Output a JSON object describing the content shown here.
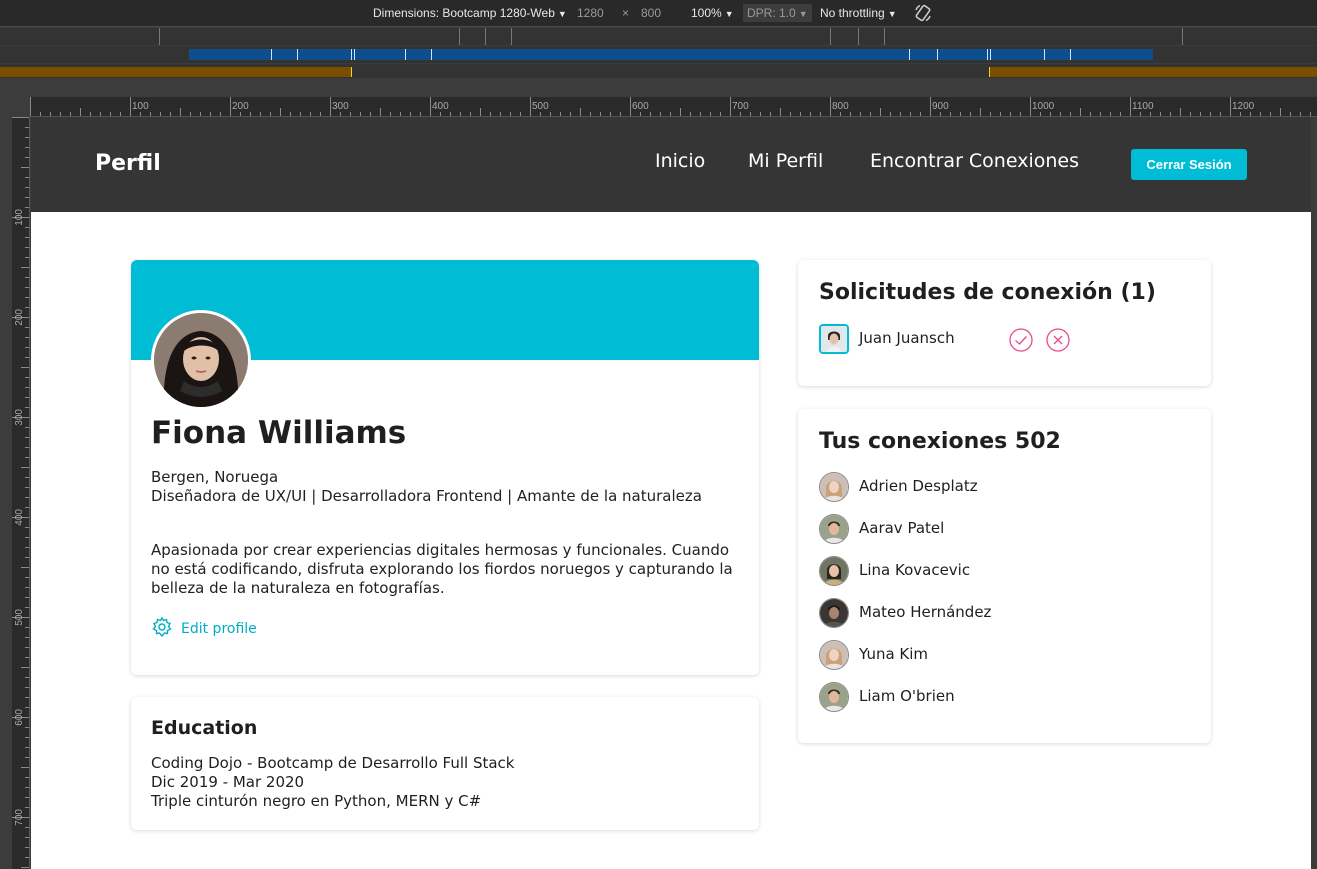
{
  "devtools": {
    "device_label": "Dimensions: Bootcamp 1280-Web",
    "width": "1280",
    "times": "×",
    "height": "800",
    "zoom": "100%",
    "dpr": "DPR: 1.0",
    "throttling": "No throttling"
  },
  "ruler": {
    "top_labels": [
      "100",
      "200",
      "300",
      "400",
      "500",
      "600",
      "700",
      "800",
      "900",
      "1000",
      "1100",
      "1200"
    ],
    "left_labels": [
      "100",
      "200",
      "300",
      "400",
      "500",
      "600",
      "700"
    ]
  },
  "nav": {
    "brand": "Perfil",
    "links": [
      "Inicio",
      "Mi Perfil",
      "Encontrar Conexiones"
    ],
    "logout": "Cerrar Sesión"
  },
  "profile": {
    "name": "Fiona Williams",
    "location": "Bergen, Noruega",
    "headline": "Diseñadora de UX/UI | Desarrolladora Frontend | Amante de la naturaleza",
    "bio": "Apasionada por crear experiencias digitales hermosas y funcionales. Cuando no está codificando, disfruta explorando los fiordos noruegos y capturando la belleza de la naturaleza en fotografías.",
    "edit_label": "Edit profile"
  },
  "education": {
    "title": "Education",
    "lines": [
      "Coding Dojo - Bootcamp de Desarrollo Full Stack",
      "Dic 2019 - Mar 2020",
      "Triple cinturón negro en Python, MERN y C#"
    ]
  },
  "requests": {
    "title": "Solicitudes de conexión (1)",
    "people": [
      "Juan Juansch"
    ]
  },
  "connections": {
    "title": "Tus conexiones 502",
    "people": [
      "Adrien Desplatz",
      "Aarav Patel",
      "Lina Kovacevic",
      "Mateo Hernández",
      "Yuna Kim",
      "Liam O'brien"
    ]
  },
  "colors": {
    "accent": "#00bcd4",
    "navbar": "#353535",
    "reject": "#e84a8a"
  }
}
